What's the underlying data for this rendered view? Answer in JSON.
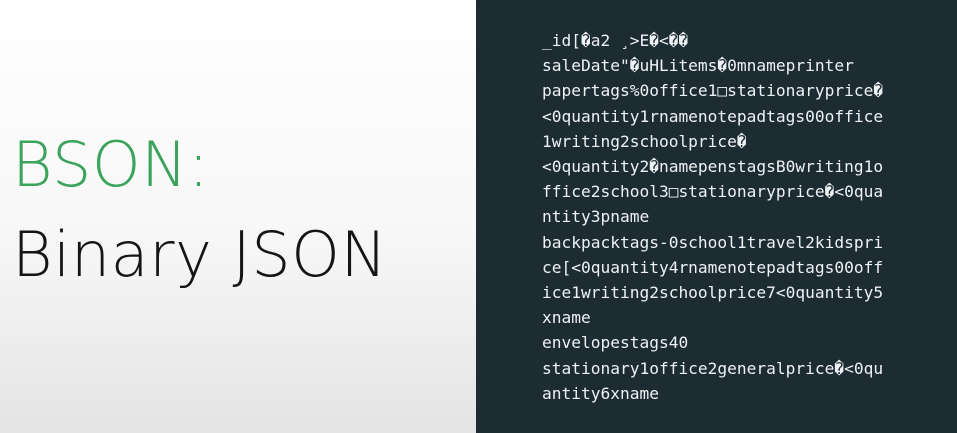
{
  "slide": {
    "title_accent": "BSON:",
    "title_main": "Binary JSON",
    "colors": {
      "accent": "#3aa35c",
      "title_text": "#151515",
      "code_background": "#1d2b33",
      "code_text": "#eef2f4"
    }
  },
  "code": {
    "lines": [
      "_id[�a2 ¸>E�<��",
      "saleDate\"�uHLitems�0mnameprinter",
      "papertags%0office1□stationaryprice�",
      "<0quantity1rnamenotepadtags00office",
      "1writing2schoolprice�",
      "<0quantity2�namepenstagsB0writing1o",
      "ffice2school3□stationaryprice�<0qua",
      "ntity3pname",
      "backpacktags-0school1travel2kidspri",
      "ce[<0quantity4rnamenotepadtags00off",
      "ice1writing2schoolprice7<0quantity5",
      "xname",
      "envelopestags40",
      "stationary1office2generalprice�<0qu",
      "antity6xname"
    ]
  }
}
